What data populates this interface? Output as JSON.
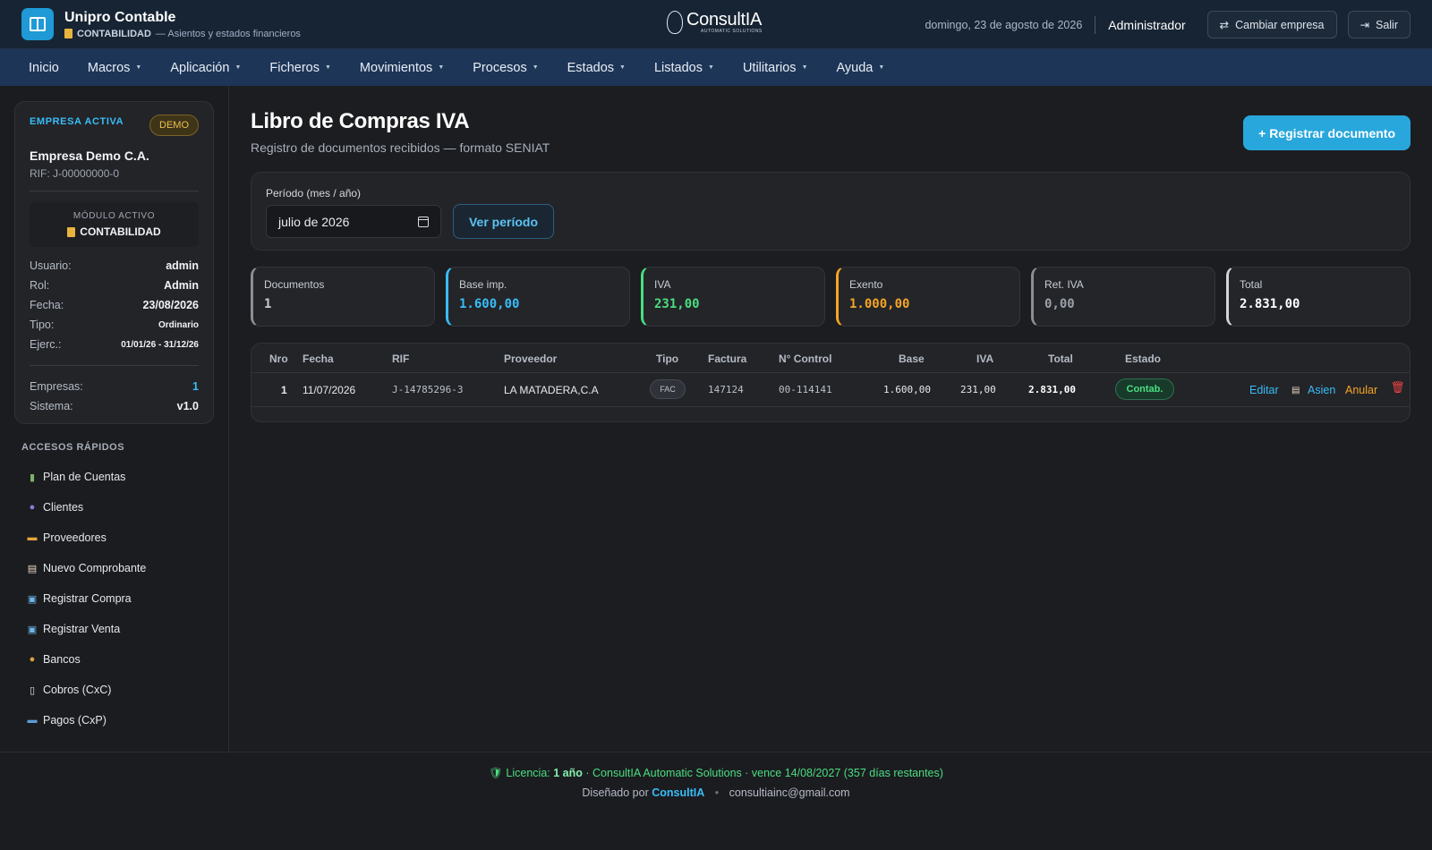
{
  "header": {
    "app_title": "Unipro Contable",
    "module_name": "CONTABILIDAD",
    "module_desc": "— Asientos y estados financieros",
    "brand": "ConsultIA",
    "brand_tag": "AUTOMATIC SOLUTIONS",
    "date": "domingo, 23 de agosto de 2026",
    "user": "Administrador",
    "switch_company": "Cambiar empresa",
    "logout": "Salir"
  },
  "nav": [
    {
      "label": "Inicio",
      "caret": false
    },
    {
      "label": "Macros",
      "caret": true
    },
    {
      "label": "Aplicación",
      "caret": true
    },
    {
      "label": "Ficheros",
      "caret": true
    },
    {
      "label": "Movimientos",
      "caret": true
    },
    {
      "label": "Procesos",
      "caret": true
    },
    {
      "label": "Estados",
      "caret": true
    },
    {
      "label": "Listados",
      "caret": true
    },
    {
      "label": "Utilitarios",
      "caret": true
    },
    {
      "label": "Ayuda",
      "caret": true
    }
  ],
  "sidebar": {
    "company_label": "EMPRESA ACTIVA",
    "badge": "DEMO",
    "company_name": "Empresa Demo C.A.",
    "rif": "RIF: J-00000000-0",
    "module_label": "MÓDULO ACTIVO",
    "module_value": "CONTABILIDAD",
    "info": [
      {
        "k": "Usuario:",
        "v": "admin"
      },
      {
        "k": "Rol:",
        "v": "Admin"
      },
      {
        "k": "Fecha:",
        "v": "23/08/2026"
      },
      {
        "k": "Tipo:",
        "v": "Ordinario"
      },
      {
        "k": "Ejerc.:",
        "v": "01/01/26 - 31/12/26"
      }
    ],
    "stats": [
      {
        "k": "Empresas:",
        "v": "1"
      },
      {
        "k": "Sistema:",
        "v": "v1.0"
      }
    ],
    "quick_title": "ACCESOS RÁPIDOS",
    "quick": [
      {
        "label": "Plan de Cuentas",
        "icon": "books-icon"
      },
      {
        "label": "Clientes",
        "icon": "users-icon"
      },
      {
        "label": "Proveedores",
        "icon": "truck-icon"
      },
      {
        "label": "Nuevo Comprobante",
        "icon": "memo-icon"
      },
      {
        "label": "Registrar Compra",
        "icon": "register-icon"
      },
      {
        "label": "Registrar Venta",
        "icon": "register-icon"
      },
      {
        "label": "Bancos",
        "icon": "money-bag-icon"
      },
      {
        "label": "Cobros (CxC)",
        "icon": "receipt-icon"
      },
      {
        "label": "Pagos (CxP)",
        "icon": "card-icon"
      }
    ]
  },
  "main": {
    "title": "Libro de Compras IVA",
    "subtitle": "Registro de documentos recibidos — formato SENIAT",
    "primary_button": "+ Registrar documento",
    "period_label": "Período (mes / año)",
    "period_value": "julio de 2026",
    "period_button": "Ver período",
    "kpis": [
      {
        "label": "Documentos",
        "value": "1",
        "color": "#8a8f96"
      },
      {
        "label": "Base imp.",
        "value": "1.600,00",
        "color": "#38bdf8"
      },
      {
        "label": "IVA",
        "value": "231,00",
        "color": "#4ade80"
      },
      {
        "label": "Exento",
        "value": "1.000,00",
        "color": "#f5a524"
      },
      {
        "label": "Ret. IVA",
        "value": "0,00",
        "color": "#8a8f96"
      },
      {
        "label": "Total",
        "value": "2.831,00",
        "color": "#d1d5db"
      }
    ],
    "table": {
      "headers": [
        "Nro",
        "Fecha",
        "RIF",
        "Proveedor",
        "Tipo",
        "Factura",
        "N° Control",
        "Base",
        "IVA",
        "Total",
        "Estado"
      ],
      "rows": [
        {
          "nro": "1",
          "fecha": "11/07/2026",
          "rif": "J-14785296-3",
          "proveedor": "LA MATADERA,C.A",
          "tipo": "FAC",
          "factura": "147124",
          "control": "00-114141",
          "base": "1.600,00",
          "iva": "231,00",
          "total": "2.831,00",
          "estado": "Contab.",
          "actions": {
            "edit": "Editar",
            "entry": "Asien",
            "void": "Anular"
          }
        }
      ]
    }
  },
  "footer": {
    "license_prefix": "Licencia:",
    "license_term": "1 año",
    "license_rest": "· ConsultIA Automatic Solutions · vence 14/08/2027 (357 días restantes)",
    "designed_by": "Diseñado por",
    "designer": "ConsultIA",
    "email": "consultiainc@gmail.com"
  }
}
